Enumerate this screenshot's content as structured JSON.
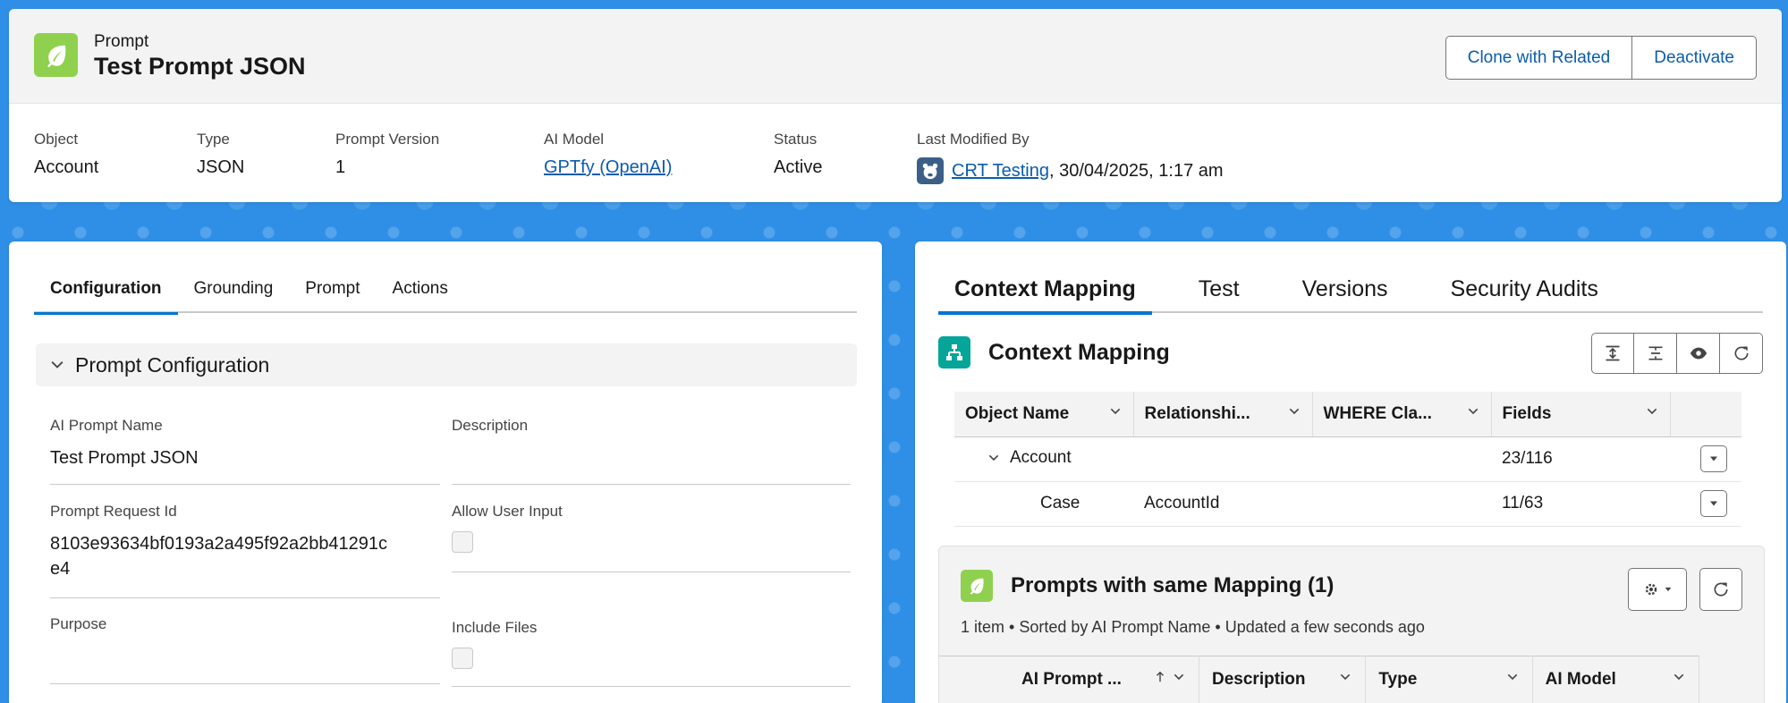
{
  "header": {
    "object_type": "Prompt",
    "title": "Test Prompt JSON",
    "buttons": {
      "clone": "Clone with Related",
      "deactivate": "Deactivate"
    },
    "fields": [
      {
        "label": "Object",
        "value": "Account"
      },
      {
        "label": "Type",
        "value": "JSON"
      },
      {
        "label": "Prompt Version",
        "value": "1"
      },
      {
        "label": "AI Model",
        "value": "GPTfy (OpenAI)"
      },
      {
        "label": "Status",
        "value": "Active"
      }
    ],
    "last_modified": {
      "label": "Last Modified By",
      "user": "CRT Testing",
      "date": ", 30/04/2025, 1:17 am"
    }
  },
  "left": {
    "tabs": [
      "Configuration",
      "Grounding",
      "Prompt",
      "Actions"
    ],
    "section_title": "Prompt Configuration",
    "fields": {
      "name": {
        "label": "AI Prompt Name",
        "value": "Test Prompt JSON"
      },
      "description": {
        "label": "Description",
        "value": ""
      },
      "request_id": {
        "label": "Prompt Request Id",
        "value_line1": "8103e93634bf0193a2a495f92a2bb41291c",
        "value_line2": "e4"
      },
      "allow_user_input": {
        "label": "Allow User Input",
        "checked": false
      },
      "purpose": {
        "label": "Purpose",
        "value": ""
      },
      "include_files": {
        "label": "Include Files",
        "checked": false
      }
    }
  },
  "right": {
    "tabs": [
      "Context Mapping",
      "Test",
      "Versions",
      "Security Audits"
    ],
    "context_mapping": {
      "title": "Context Mapping",
      "columns": [
        "Object Name",
        "Relationshi...",
        "WHERE Cla...",
        "Fields"
      ],
      "rows": [
        {
          "object": "Account",
          "relationship": "",
          "where": "",
          "fields": "23/116"
        },
        {
          "object": "Case",
          "relationship": "AccountId",
          "where": "",
          "fields": "11/63"
        }
      ]
    },
    "related": {
      "title": "Prompts with same Mapping (1)",
      "subtitle": "1 item • Sorted by AI Prompt Name • Updated a few seconds ago",
      "columns": [
        "AI Prompt ...",
        "Description",
        "Type",
        "AI Model"
      ]
    }
  },
  "colors": {
    "accent": "#0176d3",
    "link": "#0b5cab",
    "prompt_icon": "#8fd14f",
    "mapping_icon": "#06a59a"
  },
  "icons": [
    "leaf-icon",
    "avatar-bear-icon",
    "chevron-down-icon",
    "hierarchy-icon",
    "expand-all-icon",
    "collapse-all-icon",
    "preview-icon",
    "refresh-icon",
    "gear-icon",
    "sort-up-icon"
  ]
}
